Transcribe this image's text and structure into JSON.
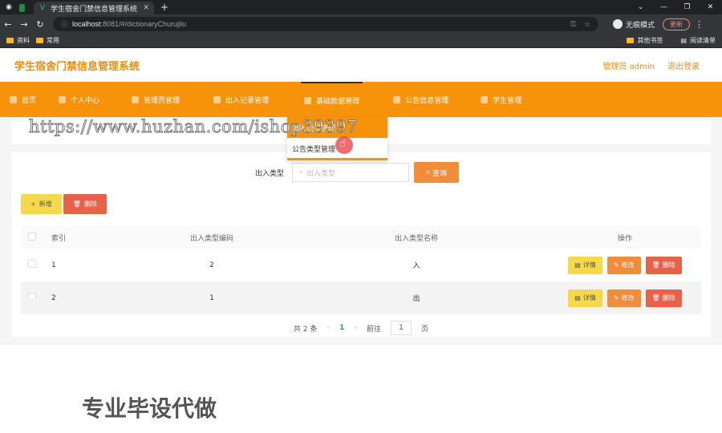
{
  "browser": {
    "tab_title": "学生宿舍门禁信息管理系统",
    "url_host": "localhost",
    "url_path": ":8081/#/dictionaryChurujilu",
    "incognito_label": "无痕模式",
    "update_label": "更新",
    "bookmarks": [
      "资料",
      "常用"
    ],
    "bookmarks_right": [
      "其他书签",
      "阅读清单"
    ]
  },
  "app": {
    "title": "学生宿舍门禁信息管理系统",
    "user_label": "管理员 admin",
    "logout_label": "退出登录"
  },
  "menu": [
    {
      "label": "首页"
    },
    {
      "label": "个人中心"
    },
    {
      "label": "管理员管理"
    },
    {
      "label": "出入记录管理"
    },
    {
      "label": "基础数据管理"
    },
    {
      "label": "公告信息管理"
    },
    {
      "label": "学生管理"
    }
  ],
  "dropdown": {
    "items": [
      "出入类型管理",
      "公告类型管理"
    ]
  },
  "search": {
    "label": "出入类型",
    "placeholder": "出入类型",
    "button": "查询"
  },
  "actions": {
    "add": "新增",
    "delete": "删除"
  },
  "table": {
    "headers": [
      "索引",
      "出入类型编码",
      "出入类型名称",
      "操作"
    ],
    "rows": [
      {
        "index": "1",
        "code": "2",
        "name": "入"
      },
      {
        "index": "2",
        "code": "1",
        "name": "出"
      }
    ],
    "row_ops": {
      "detail": "详情",
      "edit": "修改",
      "delete": "删除"
    }
  },
  "pager": {
    "total": "共 2 条",
    "current": "1",
    "goto_label": "前往",
    "goto_value": "1",
    "page_suffix": "页"
  },
  "watermarks": [
    "https://www.huzhan.com/ishop39397",
    "专业毕设代做"
  ],
  "colors": {
    "primary": "#f7930a",
    "title": "#f08c0a",
    "danger": "#e8624a",
    "warning": "#f5d94a",
    "pager_active": "#1a9e7a"
  }
}
